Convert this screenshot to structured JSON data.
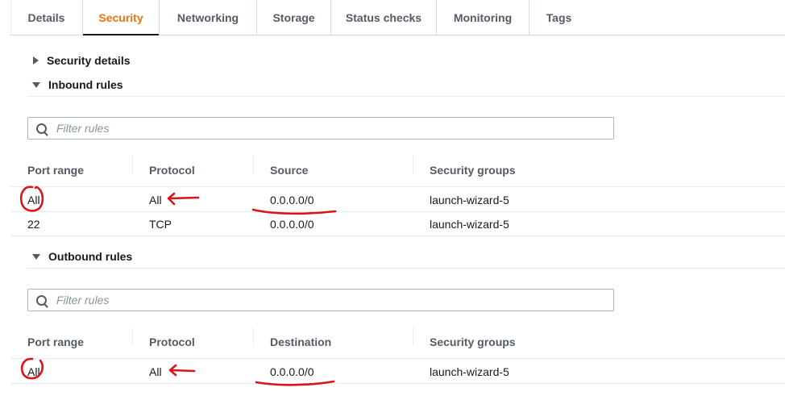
{
  "tabs": [
    {
      "label": "Details",
      "active": false
    },
    {
      "label": "Security",
      "active": true
    },
    {
      "label": "Networking",
      "active": false
    },
    {
      "label": "Storage",
      "active": false
    },
    {
      "label": "Status checks",
      "active": false
    },
    {
      "label": "Monitoring",
      "active": false
    },
    {
      "label": "Tags",
      "active": false
    }
  ],
  "security_details": {
    "label": "Security details",
    "expanded": false
  },
  "inbound": {
    "label": "Inbound rules",
    "expanded": true,
    "filter_placeholder": "Filter rules",
    "columns": [
      "Port range",
      "Protocol",
      "Source",
      "Security groups"
    ],
    "rows": [
      [
        "All",
        "All",
        "0.0.0.0/0",
        "launch-wizard-5"
      ],
      [
        "22",
        "TCP",
        "0.0.0.0/0",
        "launch-wizard-5"
      ]
    ]
  },
  "outbound": {
    "label": "Outbound rules",
    "expanded": true,
    "filter_placeholder": "Filter rules",
    "columns": [
      "Port range",
      "Protocol",
      "Destination",
      "Security groups"
    ],
    "rows": [
      [
        "All",
        "All",
        "0.0.0.0/0",
        "launch-wizard-5"
      ]
    ]
  },
  "colors": {
    "active_tab": "#ec7211",
    "annotation": "#d9141c",
    "text": "#16191f",
    "muted": "#545b64"
  }
}
